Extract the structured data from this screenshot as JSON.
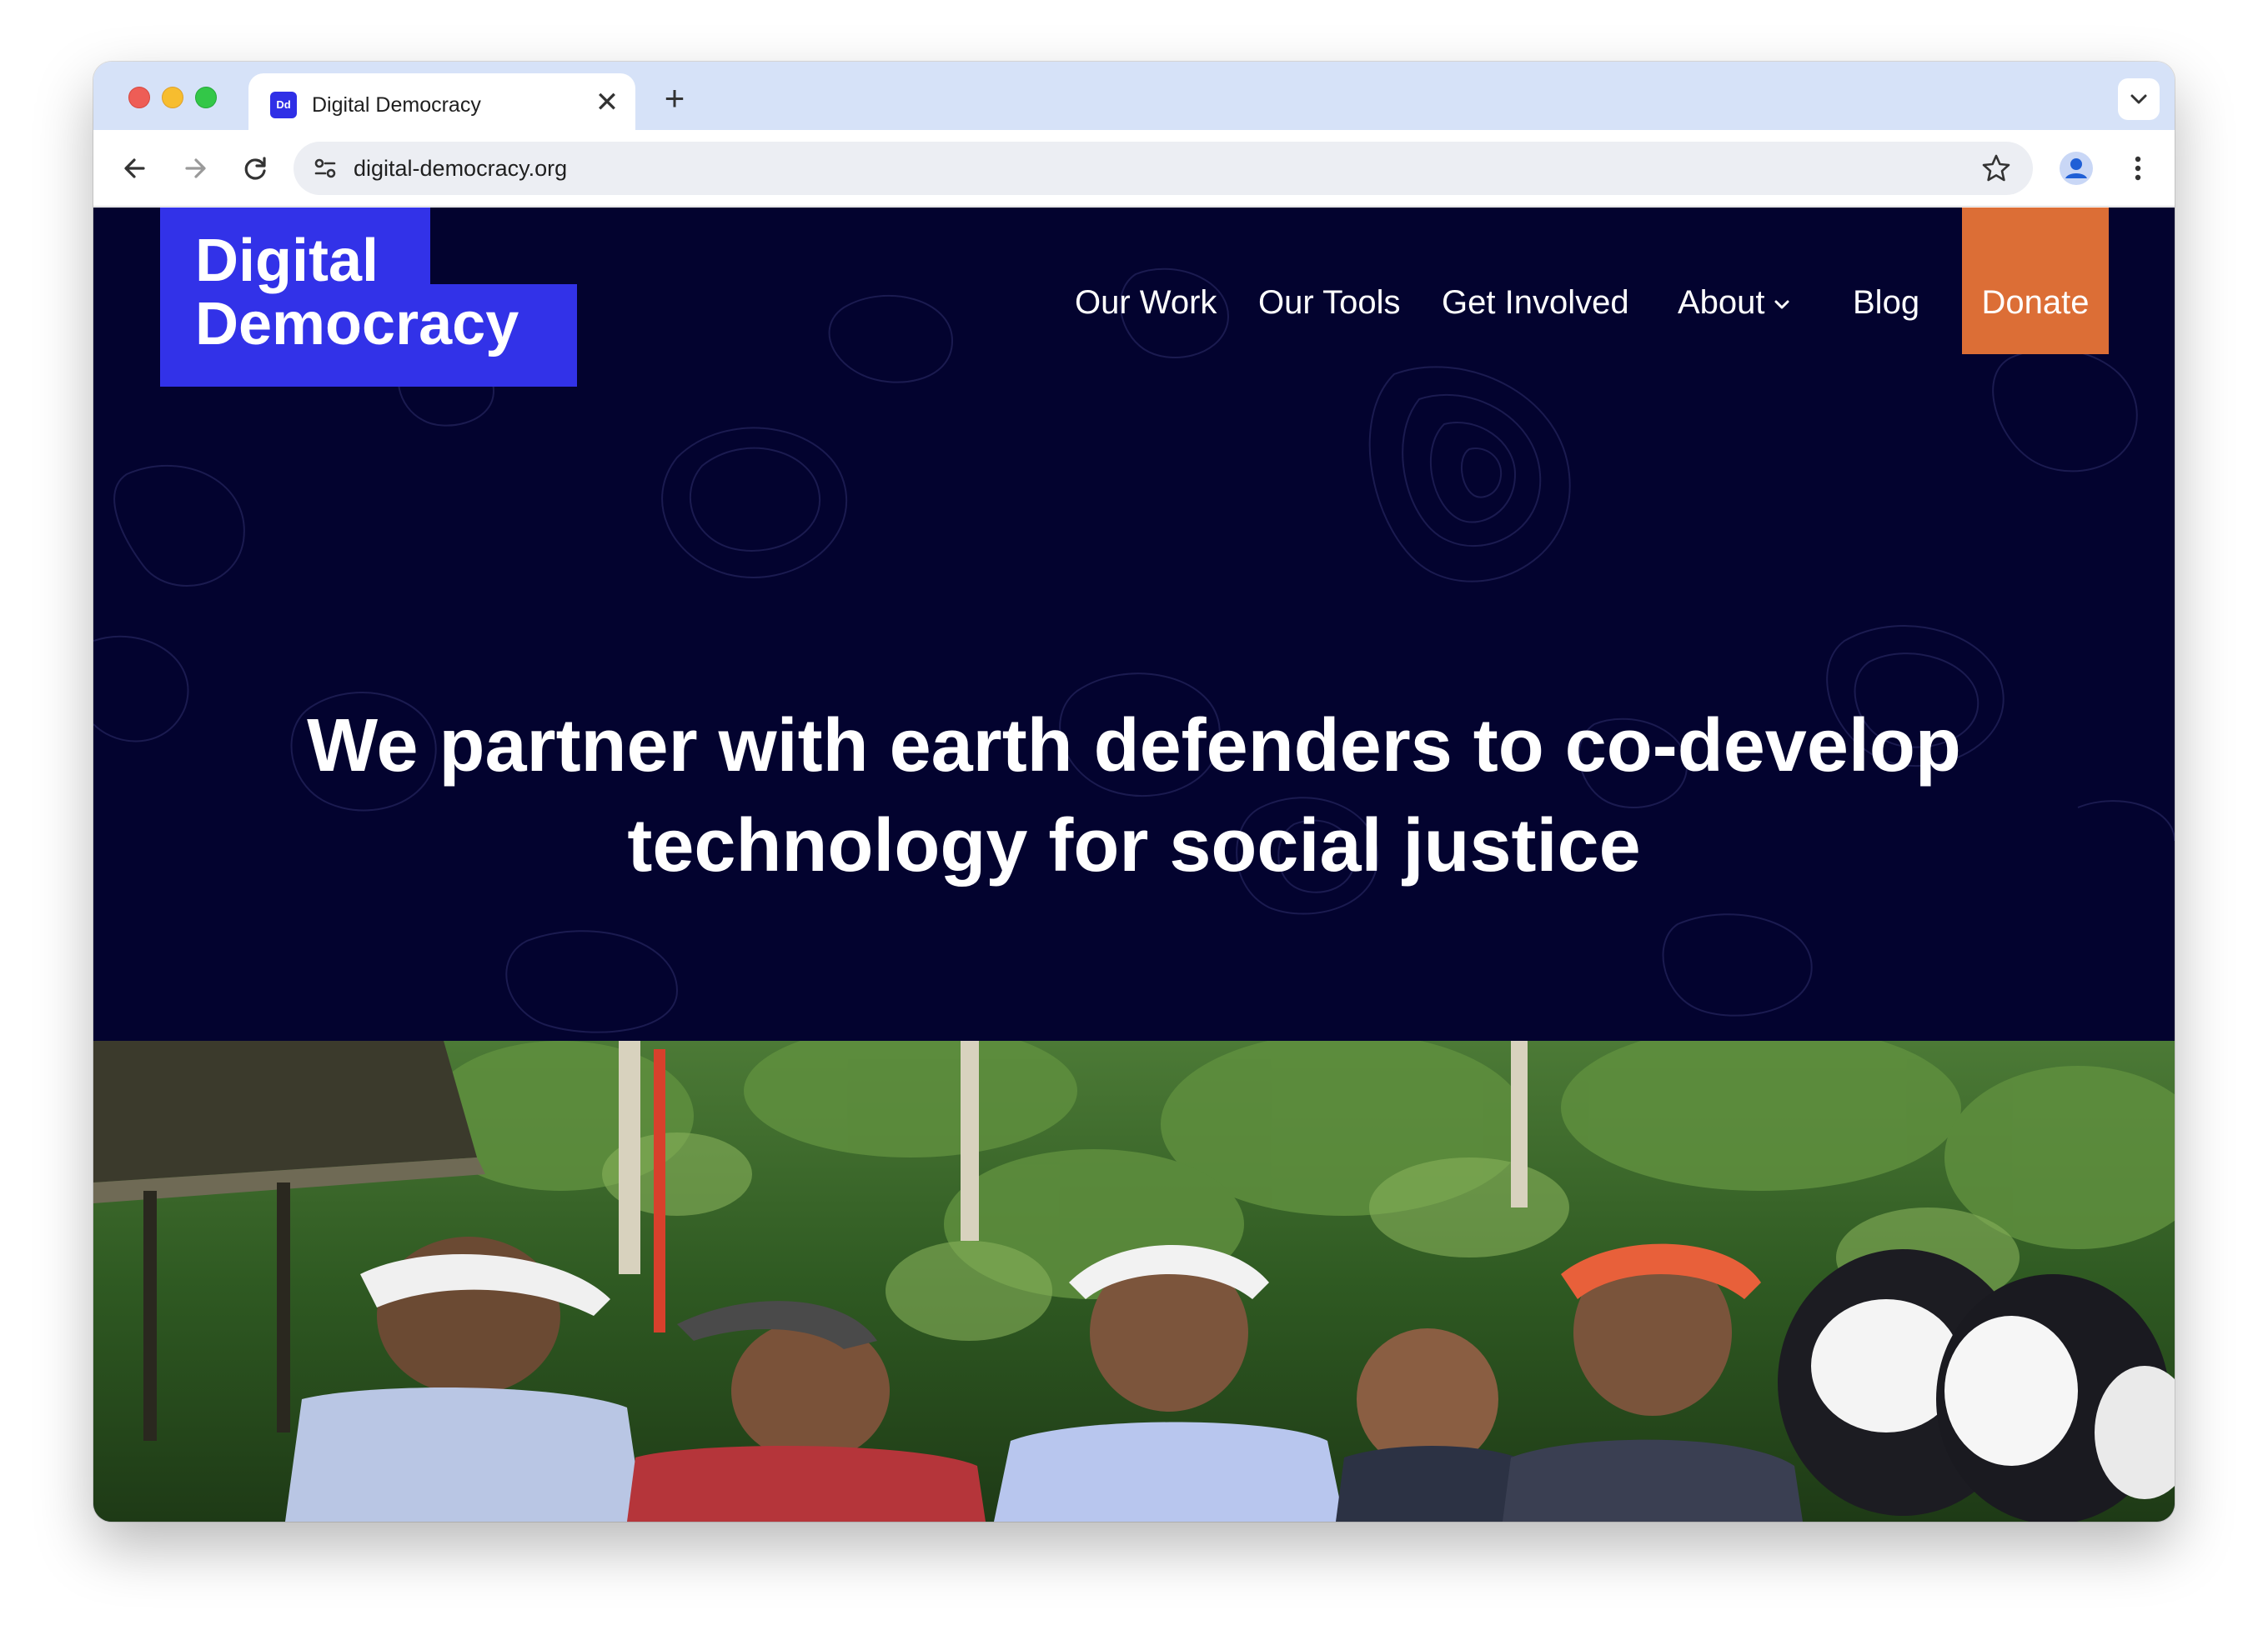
{
  "browser": {
    "tab": {
      "title": "Digital Democracy",
      "favicon_text": "Dd",
      "close_glyph": "✕"
    },
    "new_tab_glyph": "+",
    "address_bar": {
      "url": "digital-democracy.org"
    }
  },
  "site": {
    "logo": {
      "line1": "Digital",
      "line2": "Democracy"
    },
    "nav": {
      "our_work": "Our Work",
      "our_tools": "Our Tools",
      "get_involved": "Get Involved",
      "about": "About",
      "blog": "Blog"
    },
    "donate_label": "Donate",
    "hero": {
      "headline": "We partner with earth defenders to co-develop technology for social justice"
    }
  },
  "colors": {
    "hero_bg": "#03032f",
    "logo_bg": "#3232e8",
    "donate_bg": "#dc6e36",
    "tabstrip_bg": "#d6e2f8"
  },
  "icons": [
    "close-icon",
    "plus-icon",
    "chevron-down-icon",
    "back-arrow-icon",
    "forward-arrow-icon",
    "reload-icon",
    "site-info-icon",
    "bookmark-star-icon",
    "profile-icon",
    "more-vert-icon"
  ]
}
